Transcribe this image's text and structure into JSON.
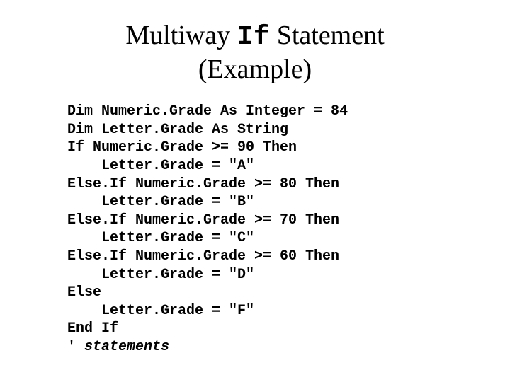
{
  "title": {
    "pre": "Multiway ",
    "mono": "If",
    "post": " Statement",
    "line2": "(Example)"
  },
  "code": {
    "l1": "Dim Numeric.Grade As Integer = 84",
    "l2": "Dim Letter.Grade As String",
    "l3": "If Numeric.Grade >= 90 Then",
    "l4": "    Letter.Grade = \"A\"",
    "l5": "Else.If Numeric.Grade >= 80 Then",
    "l6": "    Letter.Grade = \"B\"",
    "l7": "Else.If Numeric.Grade >= 70 Then",
    "l8": "    Letter.Grade = \"C\"",
    "l9": "Else.If Numeric.Grade >= 60 Then",
    "l10": "    Letter.Grade = \"D\"",
    "l11": "Else",
    "l12": "    Letter.Grade = \"F\"",
    "l13": "End If",
    "l14_prefix": "' ",
    "l14_comment": "statements"
  }
}
